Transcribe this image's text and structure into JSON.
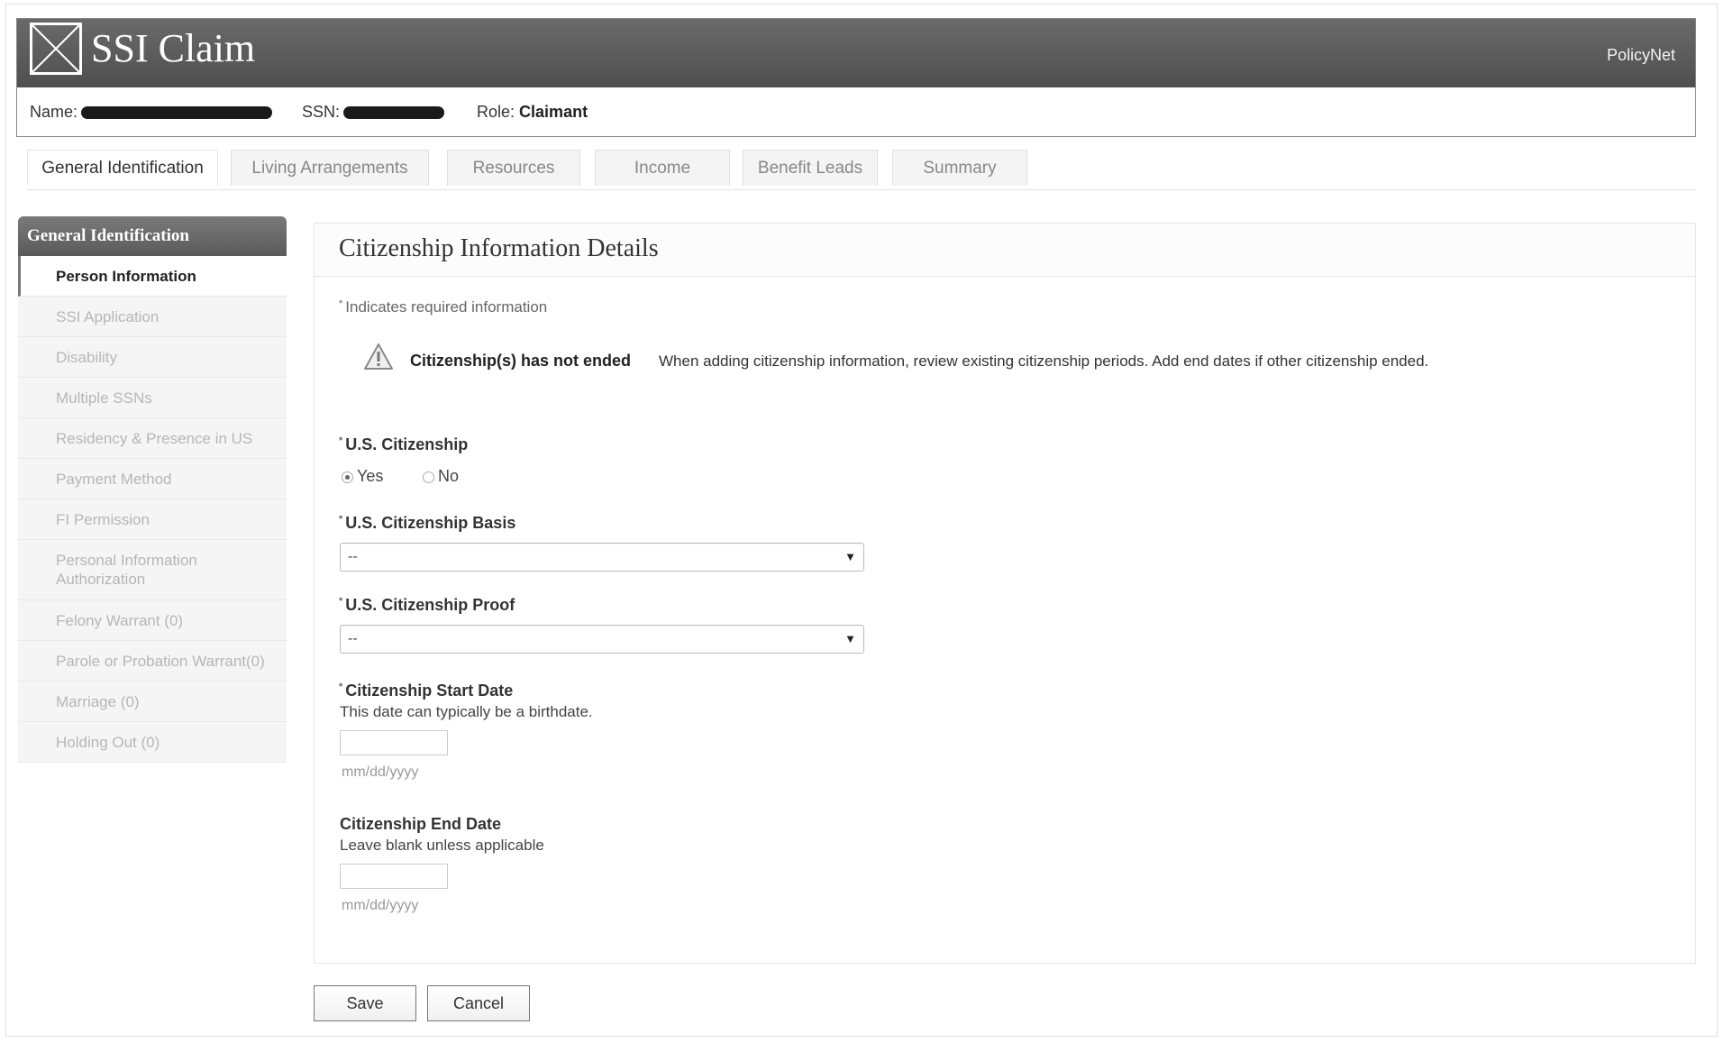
{
  "header": {
    "title": "SSI Claim",
    "brand": "PolicyNet",
    "name_label": "Name:",
    "ssn_label": "SSN:",
    "role_label": "Role:",
    "role_value": "Claimant",
    "logo_icon": "x-box-icon",
    "bar_color": "#5a5a5a"
  },
  "tabs": [
    {
      "label": "General Identification",
      "active": true
    },
    {
      "label": "Living Arrangements"
    },
    {
      "label": "Resources"
    },
    {
      "label": "Income"
    },
    {
      "label": "Benefit Leads"
    },
    {
      "label": "Summary"
    }
  ],
  "sidebar": {
    "title": "General Identification",
    "items": [
      {
        "label": "Person Information",
        "active": true
      },
      {
        "label": "SSI Application"
      },
      {
        "label": "Disability"
      },
      {
        "label": "Multiple SSNs"
      },
      {
        "label": "Residency & Presence in US"
      },
      {
        "label": "Payment Method"
      },
      {
        "label": "FI Permission"
      },
      {
        "label": "Personal Information Authorization"
      },
      {
        "label": "Felony Warrant (0)"
      },
      {
        "label": "Parole or Probation Warrant(0)"
      },
      {
        "label": "Marriage (0)"
      },
      {
        "label": "Holding Out (0)"
      }
    ]
  },
  "main": {
    "title": "Citizenship Information Details",
    "required_marker": "*",
    "required_note": "Indicates required information",
    "warning": {
      "icon": "warning-triangle-icon",
      "title": "Citizenship(s) has not ended",
      "text": "When adding citizenship information, review existing citizenship periods.  Add end dates if other citizenship ended."
    },
    "citizenship": {
      "label": "U.S. Citizenship",
      "options": [
        "Yes",
        "No"
      ],
      "selected": "Yes"
    },
    "basis": {
      "label": "U.S. Citizenship Basis",
      "value": "--"
    },
    "proof": {
      "label": "U.S. Citizenship Proof",
      "value": "--"
    },
    "start_date": {
      "label": "Citizenship Start Date",
      "help": "This date can typically be a birthdate.",
      "value": "",
      "hint": "mm/dd/yyyy"
    },
    "end_date": {
      "label": "Citizenship End Date",
      "help": "Leave blank unless applicable",
      "value": "",
      "hint": "mm/dd/yyyy"
    }
  },
  "buttons": {
    "save": "Save",
    "cancel": "Cancel"
  }
}
